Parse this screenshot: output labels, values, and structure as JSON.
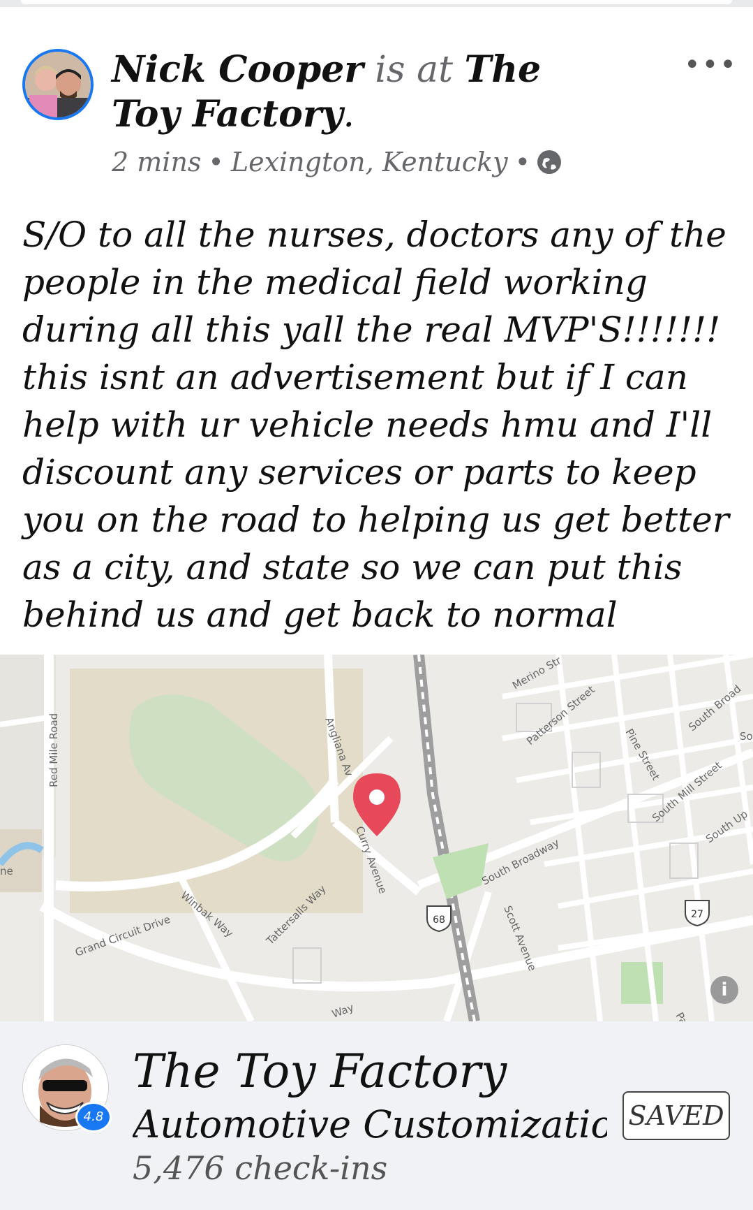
{
  "post": {
    "author": "Nick Cooper",
    "verb": "is at",
    "place": "The Toy Factory",
    "period": ".",
    "time": "2 mins",
    "sep": "•",
    "location": "Lexington, Kentucky",
    "privacy_icon": "globe-icon",
    "body": "S/O to all the nurses, doctors any of the people in the medical field working during all this yall the real MVP'S!!!!!!! this isnt an advertisement but if I can help with ur vehicle needs hmu and I'll discount any services or parts to keep you on the road to helping us get better as a city, and state so we can put this behind us and get back to normal",
    "more_label": "•••"
  },
  "map": {
    "streets": [
      "Red Mile Road",
      "Angliana Av",
      "Curry Avenue",
      "Grand Circuit Drive",
      "Winbak Way",
      "Tattersalls Way",
      "Merino Str",
      "Patterson Street",
      "Pine Street",
      "South Broadway",
      "Scott Avenue",
      "South Mill Street",
      "South Up",
      "South Broad",
      "ne",
      "Way",
      "Patt",
      "So"
    ],
    "route_68": "68",
    "route_27": "27",
    "info_label": "i",
    "pin_color": "#e8495a"
  },
  "place_card": {
    "name": "The Toy Factory",
    "category": "Automotive Customizatio...",
    "checkins": "5,476 check-ins",
    "rating": "4.8",
    "saved_label": "SAVED"
  },
  "colors": {
    "accent": "#1877f2",
    "secondary_text": "#65676b",
    "card_bg": "#f0f2f5"
  }
}
